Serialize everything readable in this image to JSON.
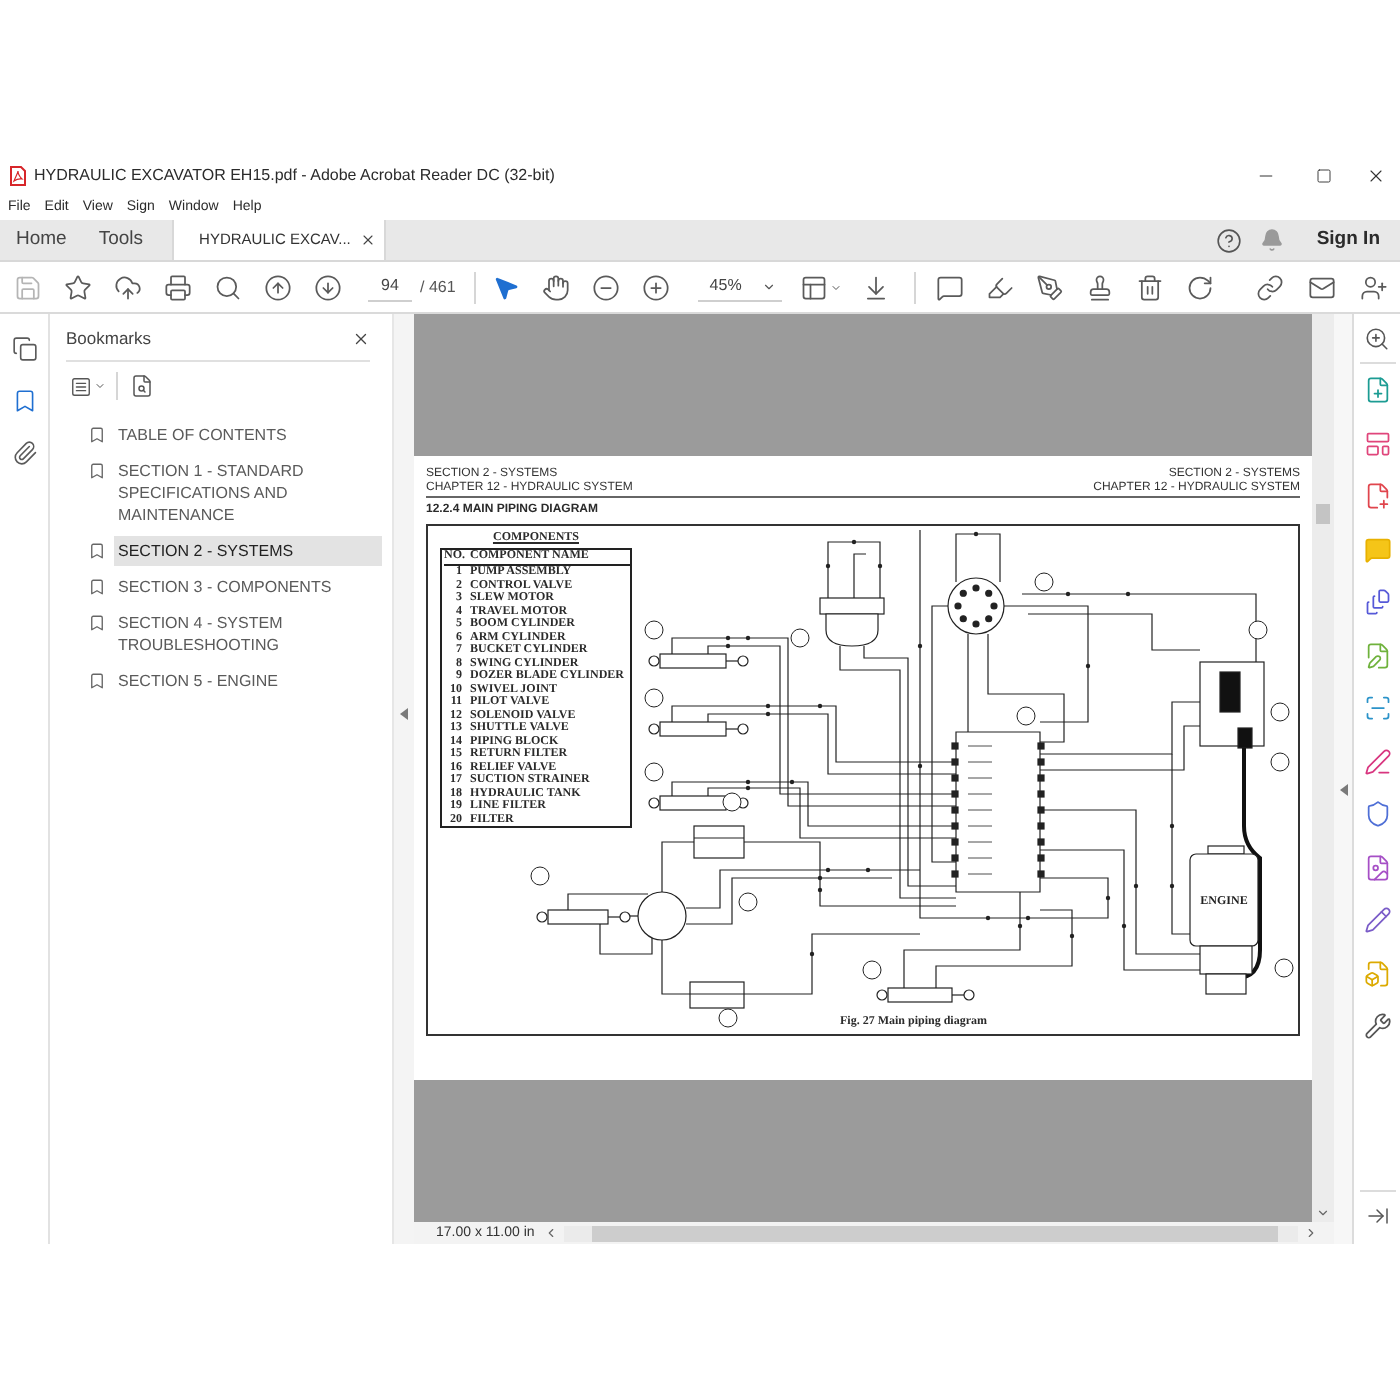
{
  "window": {
    "title": "HYDRAULIC EXCAVATOR EH15.pdf - Adobe Acrobat Reader DC (32-bit)"
  },
  "menu": [
    "File",
    "Edit",
    "View",
    "Sign",
    "Window",
    "Help"
  ],
  "tabs": [
    {
      "label": "Home",
      "selected": false,
      "closable": false
    },
    {
      "label": "Tools",
      "selected": false,
      "closable": false
    },
    {
      "label": "HYDRAULIC EXCAV...",
      "selected": true,
      "closable": true
    }
  ],
  "account": {
    "label": "Sign In"
  },
  "toolbar": {
    "page": "94",
    "page_count": "/ 461",
    "zoom": "45%",
    "tools": [
      {
        "kind": "select",
        "selected": true
      },
      {
        "kind": "hand",
        "selected": false
      }
    ]
  },
  "nav_rail": [
    {
      "kind": "pages",
      "selected": false
    },
    {
      "kind": "bookmarks",
      "selected": true
    },
    {
      "kind": "attachments",
      "selected": false
    }
  ],
  "bookmarks": {
    "title": "Bookmarks",
    "items": [
      {
        "label": "TABLE OF CONTENTS",
        "selected": false
      },
      {
        "label": "SECTION 1 - STANDARD SPECIFICATIONS AND MAINTENANCE",
        "selected": false
      },
      {
        "label": "SECTION 2 - SYSTEMS",
        "selected": true
      },
      {
        "label": "SECTION 3 - COMPONENTS",
        "selected": false
      },
      {
        "label": "SECTION 4 - SYSTEM TROUBLESHOOTING",
        "selected": false
      },
      {
        "label": "SECTION 5 - ENGINE",
        "selected": false
      }
    ]
  },
  "document": {
    "header_left": [
      "SECTION 2 - SYSTEMS",
      "CHAPTER 12 - HYDRAULIC SYSTEM"
    ],
    "header_right": [
      "SECTION 2 - SYSTEMS",
      "CHAPTER 12 - HYDRAULIC SYSTEM"
    ],
    "heading": "12.2.4 MAIN PIPING DIAGRAM",
    "components": {
      "title": "COMPONENTS",
      "columns": [
        "NO.",
        "COMPONENT NAME"
      ],
      "rows": [
        {
          "no": "1",
          "name": "PUMP ASSEMBLY"
        },
        {
          "no": "2",
          "name": "CONTROL VALVE"
        },
        {
          "no": "3",
          "name": "SLEW MOTOR"
        },
        {
          "no": "4",
          "name": "TRAVEL MOTOR"
        },
        {
          "no": "5",
          "name": "BOOM CYLINDER"
        },
        {
          "no": "6",
          "name": "ARM CYLINDER"
        },
        {
          "no": "7",
          "name": "BUCKET CYLINDER"
        },
        {
          "no": "8",
          "name": "SWING CYLINDER"
        },
        {
          "no": "9",
          "name": "DOZER BLADE CYLINDER"
        },
        {
          "no": "10",
          "name": "SWIVEL JOINT"
        },
        {
          "no": "11",
          "name": "PILOT VALVE"
        },
        {
          "no": "12",
          "name": "SOLENOID VALVE"
        },
        {
          "no": "13",
          "name": "SHUTTLE VALVE"
        },
        {
          "no": "14",
          "name": "PIPING BLOCK"
        },
        {
          "no": "15",
          "name": "RETURN FILTER"
        },
        {
          "no": "16",
          "name": "RELIEF VALVE"
        },
        {
          "no": "17",
          "name": "SUCTION STRAINER"
        },
        {
          "no": "18",
          "name": "HYDRAULIC TANK"
        },
        {
          "no": "19",
          "name": "LINE FILTER"
        },
        {
          "no": "20",
          "name": "FILTER"
        }
      ]
    },
    "engine_label": "ENGINE",
    "caption": "Fig. 27 Main piping diagram"
  },
  "status_bar": {
    "page_size": "17.00 x 11.00 in"
  }
}
